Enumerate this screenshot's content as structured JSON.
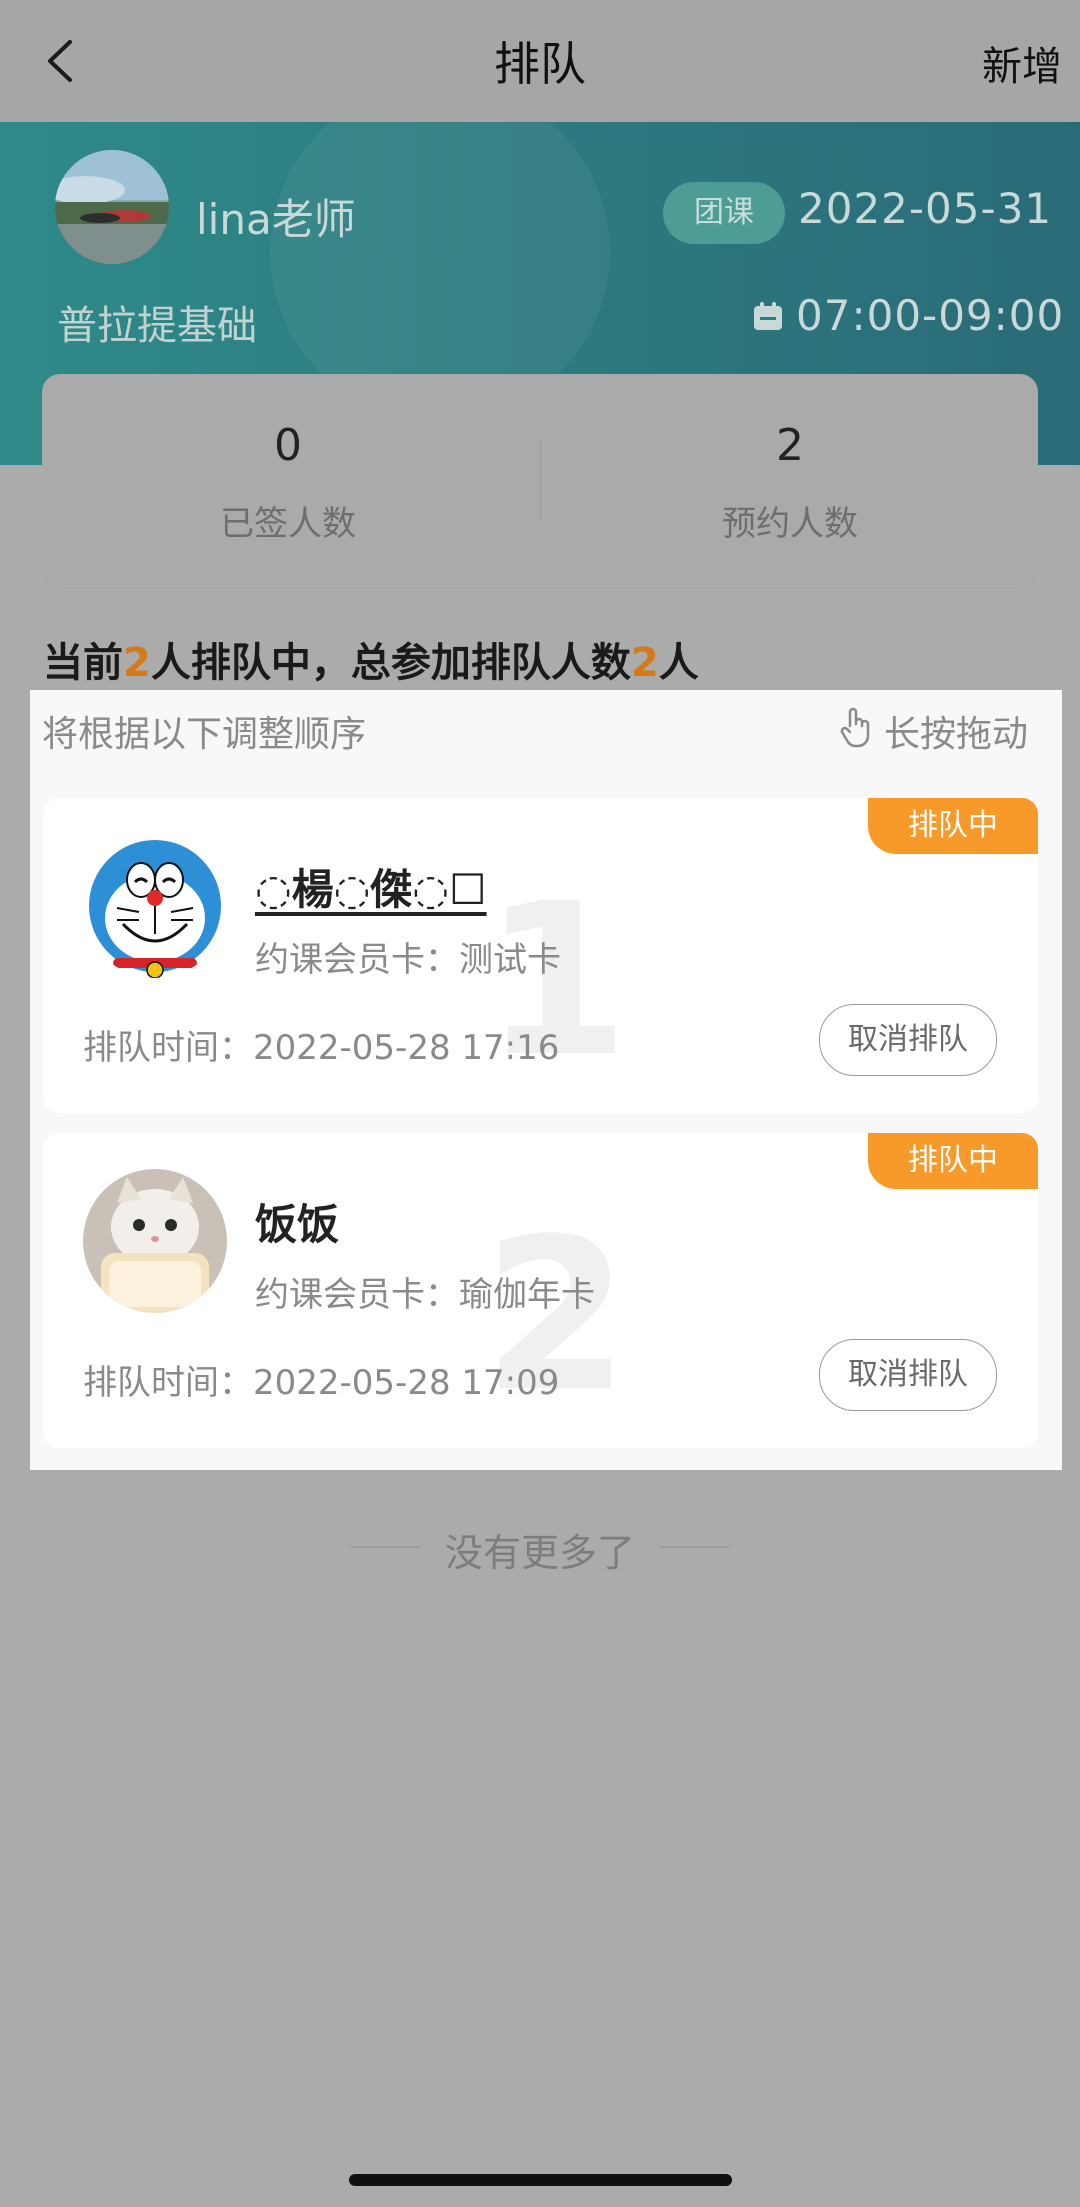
{
  "nav": {
    "title": "排队",
    "add_label": "新增"
  },
  "class_info": {
    "teacher_name": "lina老师",
    "course_type": "团课",
    "date": "2022-05-31",
    "course_name": "普拉提基础",
    "time": "07:00-09:00"
  },
  "stats": {
    "signed_count": "0",
    "signed_label": "已签人数",
    "booked_count": "2",
    "booked_label": "预约人数"
  },
  "summary": {
    "prefix": "当前",
    "current_count": "2",
    "middle": "人排队中，总参加排队人数",
    "total_count": "2",
    "suffix": "人"
  },
  "queue": {
    "hint": "将根据以下调整顺序",
    "drag_label": "长按拖动",
    "items": [
      {
        "order": "1",
        "status": "排队中",
        "name": "◌楊◌傑◌☐",
        "card": "约课会员卡：测试卡",
        "time": "排队时间：2022-05-28 17:16",
        "cancel_label": "取消排队"
      },
      {
        "order": "2",
        "status": "排队中",
        "name": "饭饭",
        "card": "约课会员卡：瑜伽年卡",
        "time": "排队时间：2022-05-28 17:09",
        "cancel_label": "取消排队"
      }
    ]
  },
  "footer": {
    "no_more": "没有更多了"
  },
  "colors": {
    "accent_orange": "#f79a2a",
    "banner_teal": "#2f8a89"
  }
}
